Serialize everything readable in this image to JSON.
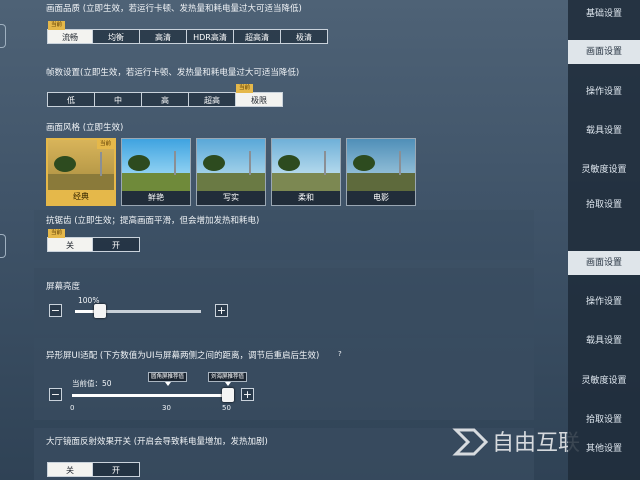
{
  "quality": {
    "title": "画面品质 (立即生效，若运行卡顿、发热量和耗电量过大可适当降低)",
    "current_tag": "当前",
    "options": [
      "流畅",
      "均衡",
      "高清",
      "HDR高清",
      "超高清",
      "极清"
    ],
    "selected": "流畅"
  },
  "fps": {
    "title": "帧数设置(立即生效，若运行卡顿、发热量和耗电量过大可适当降低)",
    "current_tag": "当前",
    "options": [
      "低",
      "中",
      "高",
      "超高",
      "极限"
    ],
    "selected": "极限"
  },
  "style": {
    "title": "画面风格 (立即生效)",
    "current_tag": "当前",
    "options": [
      "经典",
      "鲜艳",
      "写实",
      "柔和",
      "电影"
    ],
    "selected": "经典"
  },
  "antialias": {
    "title": "抗锯齿 (立即生效；提高画面平滑，但会增加发热和耗电)",
    "current_tag": "当前",
    "options": [
      "关",
      "开"
    ],
    "selected": "关"
  },
  "brightness": {
    "title": "屏幕亮度",
    "value_text": "100%",
    "level": 0.2,
    "minus": "−",
    "plus": "+"
  },
  "notch": {
    "title": "异形屏UI适配 (下方数值为UI与屏幕两侧之间的距离，调节后重启后生效)",
    "help": "?",
    "current_text": "当前值：50",
    "tip_rounded": "圆角屏推荐值",
    "tip_notch": "刘海屏推荐值",
    "tick_0": "0",
    "tick_30": "30",
    "tick_50": "50",
    "value": 50,
    "max": 50,
    "minus": "−",
    "plus": "+"
  },
  "reflection": {
    "title": "大厅镜面反射效果开关 (开启会导致耗电量增加，发热加剧)",
    "options": [
      "关",
      "开"
    ],
    "selected": "关"
  },
  "sidebar_top": [
    "基础设置",
    "画面设置",
    "操作设置",
    "载具设置",
    "灵敏度设置",
    "拾取设置"
  ],
  "sidebar_bottom": [
    "画面设置",
    "操作设置",
    "载具设置",
    "灵敏度设置",
    "拾取设置",
    "其他设置"
  ],
  "sidebar_active": "画面设置",
  "watermark": "自由互联",
  "colors": {
    "accent": "#e5b84a",
    "selected_bg": "#f3f3f0",
    "panel": "#3a4c60"
  }
}
